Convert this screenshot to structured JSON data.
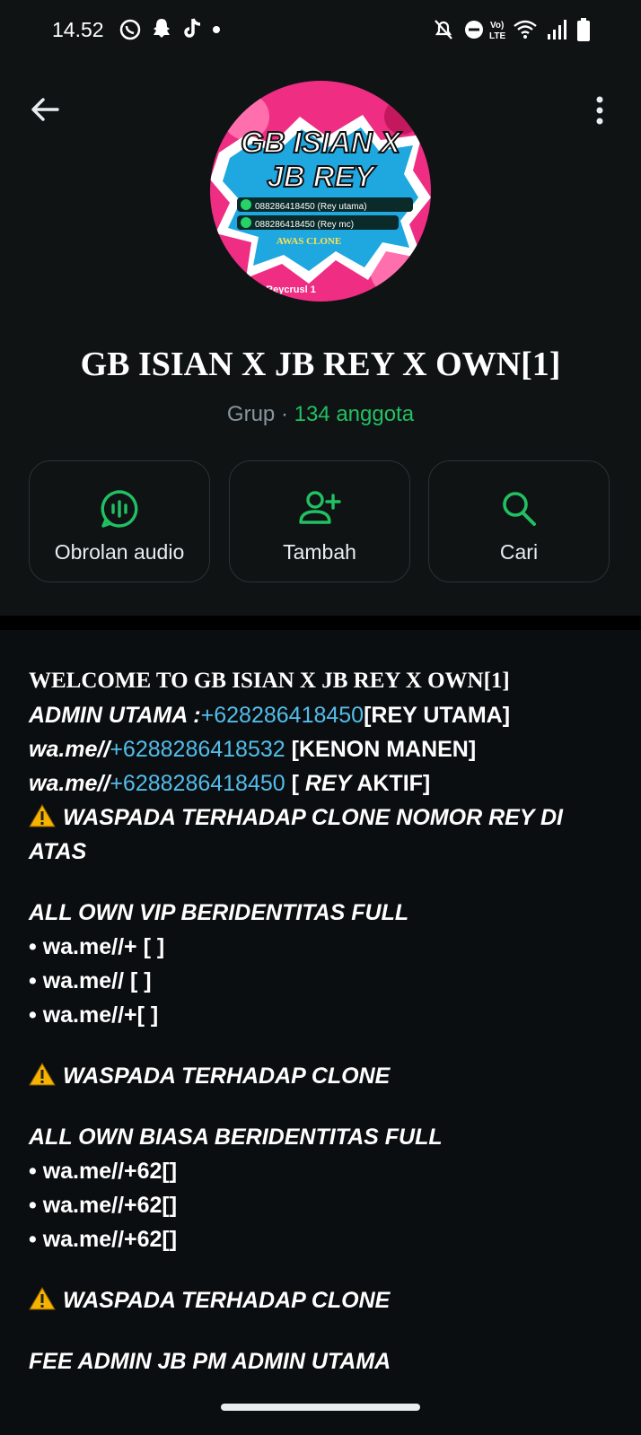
{
  "status_bar": {
    "time": "14.52"
  },
  "header": {
    "group_name": "GB ISIAN X JB REY X OWN[1]",
    "group_type": "Grup",
    "separator": " · ",
    "member_count": "134 anggota",
    "avatar_text": {
      "line1": "GB ISIAN X",
      "line2": "JB REY",
      "phone1": "088286418450 (Rey utama)",
      "phone2": "088286418450 (Rey mc)",
      "warning": "AWAS CLONE",
      "credit": "Reycrusl 1"
    }
  },
  "actions": [
    {
      "label": "Obrolan audio",
      "icon": "audio-chat-icon"
    },
    {
      "label": "Tambah",
      "icon": "add-person-icon"
    },
    {
      "label": "Cari",
      "icon": "search-icon"
    }
  ],
  "description": {
    "welcome": "WELCOME TO GB ISIAN X JB REY X OWN[1]",
    "admin_prefix": " ADMIN UTAMA :",
    "admin_phone": "+628286418450",
    "admin_suffix": "[REY UTAMA]",
    "line2_prefix": "wa.me//",
    "line2_phone": "+6288286418532",
    "line2_suffix": " [KENON MANEN]",
    "line3_prefix": "wa.me//",
    "line3_phone": "+6288286418450",
    "line3_suffix_a": " [ ",
    "line3_suffix_b": "REY",
    "line3_suffix_c": " AKTIF]",
    "warn1": "WASPADA TERHADAP CLONE NOMOR REY DI",
    "warn1_cont": "ATAS",
    "vip_title": "ALL OWN VIP BERIDENTITAS FULL",
    "vip_items": [
      "• wa.me//+ [  ]",
      "• wa.me// [ ]",
      "• wa.me//+[  ]"
    ],
    "warn2": "WASPADA TERHADAP CLONE",
    "biasa_title": "ALL OWN BIASA BERIDENTITAS FULL",
    "biasa_items": [
      "• wa.me//+62[]",
      "• wa.me//+62[]",
      "• wa.me//+62[]"
    ],
    "warn3": "WASPADA TERHADAP CLONE",
    "fee": "FEE ADMIN JB PM ADMIN UTAMA"
  },
  "colors": {
    "accent": "#21c063",
    "link": "#53bdeb",
    "background": "#0b0e10"
  }
}
